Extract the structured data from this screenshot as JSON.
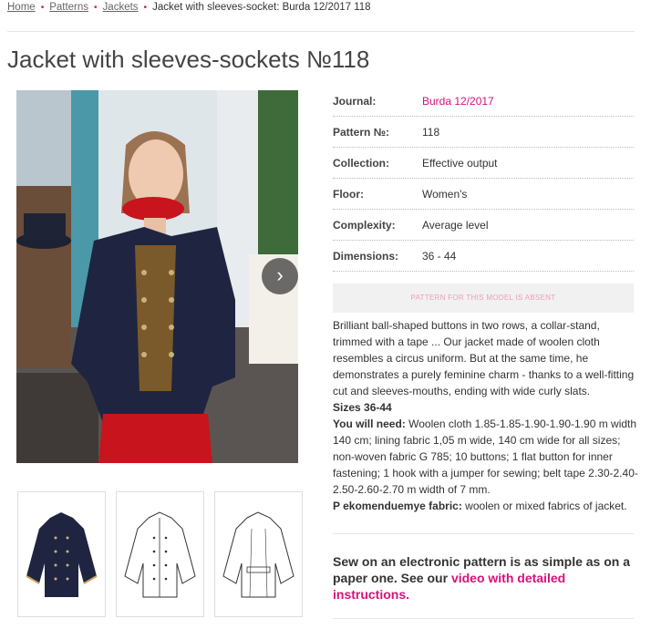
{
  "breadcrumb": {
    "home": "Home",
    "patterns": "Patterns",
    "jackets": "Jackets",
    "current": "Jacket with sleeves-socket: Burda 12/2017 118",
    "separator": "•"
  },
  "page_title": "Jacket with sleeves-sockets №118",
  "gallery": {
    "next_icon": "›"
  },
  "details": [
    {
      "label": "Journal:",
      "value": "Burda 12/2017"
    },
    {
      "label": "Pattern №:",
      "value": "118"
    },
    {
      "label": "Collection:",
      "value": "Effective output"
    },
    {
      "label": "Floor:",
      "value": "Women's"
    },
    {
      "label": "Complexity:",
      "value": "Average level"
    },
    {
      "label": "Dimensions:",
      "value": "36 - 44"
    }
  ],
  "absent_notice": "PATTERN FOR THIS MODEL IS ABSENT",
  "description": {
    "intro": "Brilliant ball-shaped buttons in two rows, a collar-stand, trimmed with a tape ... Our jacket made of woolen cloth resembles a circus uniform. But at the same time, he demonstrates a purely feminine charm - thanks to a well-fitting cut and sleeves-mouths, ending with wide curly slats.",
    "sizes": "Sizes 36-44",
    "need_label": "You will need:",
    "need_text": " Woolen cloth 1.85-1.85-1.90-1.90-1.90 m width 140 cm; lining fabric 1,05 m wide, 140 cm wide for all sizes; non-woven fabric G 785; 10 buttons; 1 flat button for inner fastening; 1 hook with a jumper for sewing; belt tape 2.30-2.40-2.50-2.60-2.70 m width of 7 mm.",
    "fabric_label": "P ekomenduemye fabric:",
    "fabric_text": " woolen or mixed fabrics of jacket."
  },
  "cta": {
    "text": "Sew on an electronic pattern is as simple as on a paper one. See our ",
    "link": "video with detailed instructions",
    "end": "."
  },
  "colors": {
    "accent": "#d6127a",
    "jacket": "#1f2540",
    "trousers": "#c8141c"
  }
}
